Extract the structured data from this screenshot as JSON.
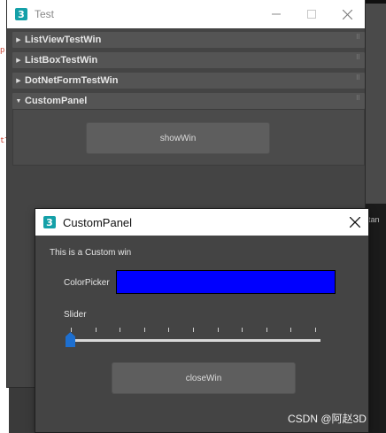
{
  "background": {
    "left_fragments": [
      "p",
      "tT"
    ],
    "right_fragment": "tan"
  },
  "test_window": {
    "title": "Test",
    "rollouts": [
      {
        "label": "ListViewTestWin",
        "expanded": false
      },
      {
        "label": "ListBoxTestWin",
        "expanded": false
      },
      {
        "label": "DotNetFormTestWin",
        "expanded": false
      },
      {
        "label": "CustomPanel",
        "expanded": true
      }
    ],
    "show_button": "showWin"
  },
  "custom_window": {
    "title": "CustomPanel",
    "message": "This is a Custom win",
    "colorpicker_label": "ColorPicker",
    "colorpicker_value": "#0000ff",
    "slider_label": "Slider",
    "slider_value": 0,
    "slider_ticks": 11,
    "close_button": "closeWin"
  },
  "watermark": "CSDN @阿赵3D",
  "colors": {
    "panel_bg": "#444444",
    "rollout_bg": "#545454",
    "button_bg": "#5e5e5e",
    "slider_thumb": "#1d6fd0",
    "app_icon": "#14a0a8"
  }
}
